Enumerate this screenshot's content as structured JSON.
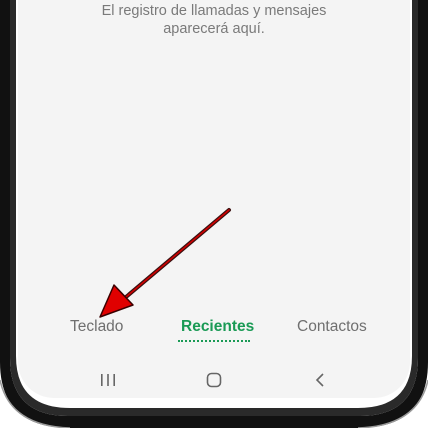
{
  "empty_state": {
    "line1": "El registro de llamadas y mensajes",
    "line2": "aparecerá aquí."
  },
  "tabs": [
    {
      "label": "Teclado",
      "active": false
    },
    {
      "label": "Recientes",
      "active": true
    },
    {
      "label": "Contactos",
      "active": false
    }
  ],
  "colors": {
    "accent": "#1a9a55",
    "screen_bg": "#f4f4f4",
    "annotation_arrow": "#d40000"
  },
  "navbar": {
    "icons": [
      "recent-apps-icon",
      "home-icon",
      "back-icon"
    ]
  }
}
